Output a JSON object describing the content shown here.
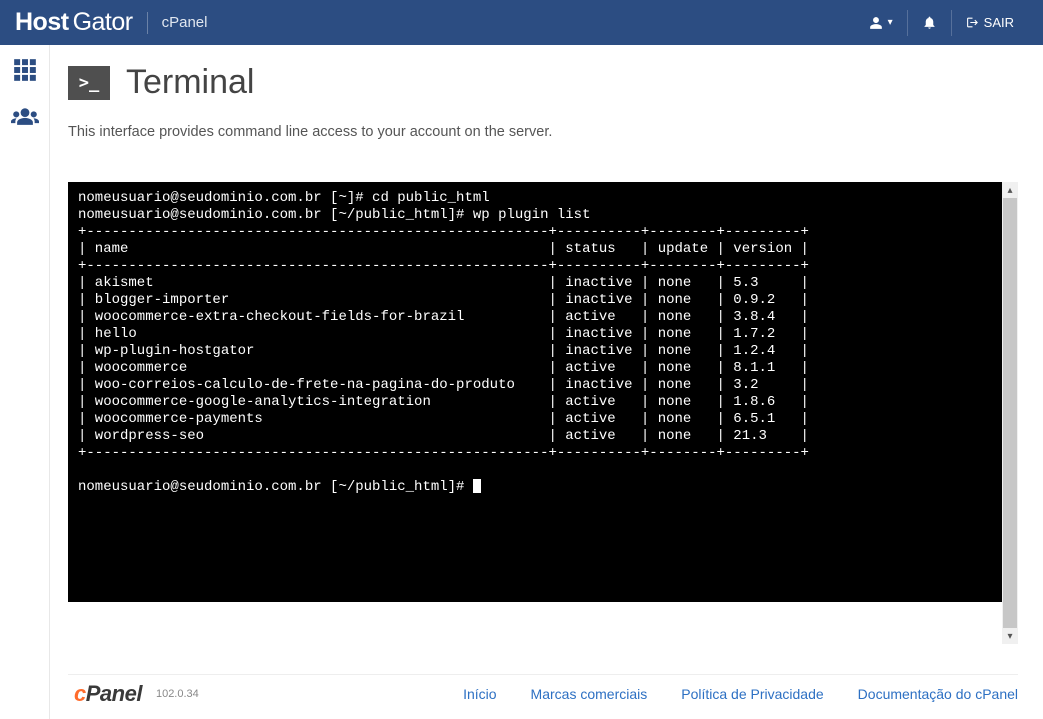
{
  "header": {
    "logo_a": "Host",
    "logo_b": "Gator",
    "subtitle": "cPanel",
    "logout": "SAIR"
  },
  "page": {
    "title": "Terminal",
    "icon_text": ">_",
    "description": "This interface provides command line access to your account on the server."
  },
  "terminal": {
    "prompt_user": "nomeusuario@seudominio.com.br",
    "lines": [
      "nomeusuario@seudominio.com.br [~]# cd public_html",
      "nomeusuario@seudominio.com.br [~/public_html]# wp plugin list",
      "+-------------------------------------------------------+----------+--------+---------+",
      "| name                                                  | status   | update | version |",
      "+-------------------------------------------------------+----------+--------+---------+",
      "| akismet                                               | inactive | none   | 5.3     |",
      "| blogger-importer                                      | inactive | none   | 0.9.2   |",
      "| woocommerce-extra-checkout-fields-for-brazil          | active   | none   | 3.8.4   |",
      "| hello                                                 | inactive | none   | 1.7.2   |",
      "| wp-plugin-hostgator                                   | inactive | none   | 1.2.4   |",
      "| woocommerce                                           | active   | none   | 8.1.1   |",
      "| woo-correios-calculo-de-frete-na-pagina-do-produto    | inactive | none   | 3.2     |",
      "| woocommerce-google-analytics-integration              | active   | none   | 1.8.6   |",
      "| woocommerce-payments                                  | active   | none   | 6.5.1   |",
      "| wordpress-seo                                         | active   | none   | 21.3    |",
      "+-------------------------------------------------------+----------+--------+---------+",
      "",
      "nomeusuario@seudominio.com.br [~/public_html]# "
    ]
  },
  "footer": {
    "logo_c": "c",
    "logo_p": "Panel",
    "version": "102.0.34",
    "links": {
      "home": "Início",
      "trademarks": "Marcas comerciais",
      "privacy": "Política de Privacidade",
      "docs": "Documentação do cPanel"
    }
  }
}
